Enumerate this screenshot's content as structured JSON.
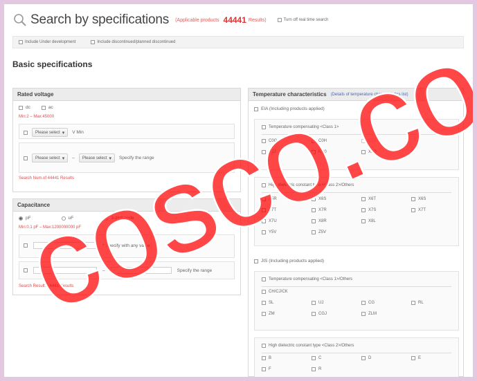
{
  "header": {
    "title": "Search by specifications",
    "applicable_label": "(Applicable products",
    "count": "44441",
    "results_label": "Results)",
    "realtime_label": "Turn off real time search"
  },
  "includes": {
    "under_dev": "Include Under development",
    "discontinued": "Include discontinued/planned discontinued"
  },
  "section_title": "Basic specifications",
  "rated_voltage": {
    "title": "Rated voltage",
    "dc": "dc",
    "ac": "ac",
    "range": "Min:2 – Max:45000",
    "select_a": "Please select",
    "unit_a": "V Min",
    "select_b": "Please select",
    "dash": "–",
    "select_c": "Please select",
    "range_label": "Specify the range",
    "results_link": "Search Num.of 44441 Results"
  },
  "capacitance": {
    "title": "Capacitance",
    "pf": "pF",
    "uf": "uF",
    "digit": "3-digit code",
    "range": "Min:0.1 pF – Max:1200000000 pF",
    "any_label": "* Specify with any value",
    "dash": "–",
    "range_label": "Specify the range",
    "results_link": "Search Result: 44441 Results"
  },
  "temperature": {
    "title": "Temperature characteristics",
    "link": "(Details of temperature characteristics list)",
    "eia": "EIA (Including products applied)",
    "class1_title": "Temperature compensating <Class 1>",
    "class1_codes": [
      {
        "code": "C0G",
        "enabled": true
      },
      {
        "code": "C0H",
        "enabled": true
      },
      {
        "code": "C0J",
        "enabled": false
      },
      {
        "code": "U2J",
        "enabled": true
      },
      {
        "code": "NP0",
        "enabled": true
      },
      {
        "code": "X8G",
        "enabled": true
      }
    ],
    "class2_title": "High dielectric constant type <Class 2>/Others",
    "class2_codes": [
      "X5R",
      "X6S",
      "X6T",
      "X6S",
      "X7T",
      "X7R",
      "X7S",
      "X7T",
      "X7U",
      "X8R",
      "X8L",
      "",
      "Y5V",
      "Z5V"
    ],
    "jis": "JIS (Including products applied)",
    "jis_class1_title": "Temperature compensating <Class 1>/Others",
    "jis_class1_top": "CH/CJ/CK",
    "jis_class1_codes": [
      "SL",
      "UJ",
      "CG",
      "RL",
      "ZM",
      "CGJ",
      "ZLM"
    ],
    "jis_class2_title": "High dielectric constant type <Class 2>/Others",
    "jis_class2_codes": [
      "B",
      "C",
      "D",
      "E",
      "F",
      "R"
    ]
  }
}
